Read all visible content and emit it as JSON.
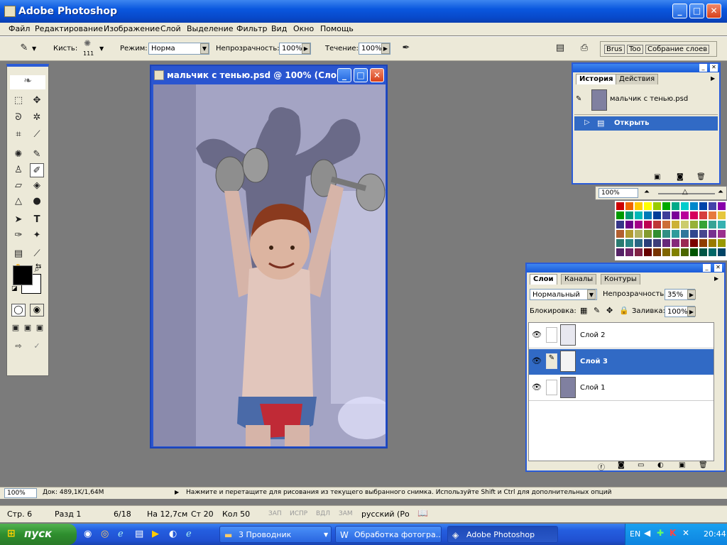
{
  "app": {
    "title": "Adobe Photoshop"
  },
  "menu": [
    "Файл",
    "Редактирование",
    "Изображение",
    "Слой",
    "Выделение",
    "Фильтр",
    "Вид",
    "Окно",
    "Помощь"
  ],
  "options": {
    "brush_label": "Кисть:",
    "brush_size": "111",
    "mode_label": "Режим:",
    "mode_value": "Норма",
    "opacity_label": "Непрозрачность:",
    "opacity_value": "100%",
    "flow_label": "Течение:",
    "flow_value": "100%",
    "well_tabs": [
      "Brus",
      "Too",
      "Собрание слоев"
    ]
  },
  "document": {
    "title": "мальчик с тенью.psd @ 100% (Сло..."
  },
  "history": {
    "tabs": [
      "История",
      "Действия"
    ],
    "snapshot": "мальчик с тенью.psd",
    "states": [
      "Открыть"
    ]
  },
  "navigator": {
    "zoom": "100%"
  },
  "layers": {
    "tabs": [
      "Слои",
      "Каналы",
      "Контуры"
    ],
    "blend_mode": "Нормальный",
    "opacity_label": "Непрозрачность:",
    "opacity_value": "35%",
    "lock_label": "Блокировка:",
    "fill_label": "Заливка:",
    "fill_value": "100%",
    "items": [
      "Слой 2",
      "Слой 3",
      "Слой 1"
    ]
  },
  "status": {
    "zoom": "100%",
    "doc": "Док: 489,1K/1,64M",
    "hint": "Нажмите и перетащите для рисования из текущего выбранного снимка. Используйте Shift и Ctrl для дополнительных опций"
  },
  "statusbar2": {
    "page": "Стр. 6",
    "section": "Разд 1",
    "pages": "6/18",
    "pos": "На 12,7см",
    "line": "Ст 20",
    "col": "Кол 50",
    "rec": "ЗАП",
    "trk": "ИСПР",
    "ext": "ВДЛ",
    "ovr": "ЗАМ",
    "lang": "русский (Ро"
  },
  "taskbar": {
    "start": "пуск",
    "tasks": [
      "3 Проводник",
      "Обработка фотогра...",
      "Adobe Photoshop"
    ],
    "lang": "EN",
    "time": "20:44"
  },
  "colors": {
    "accent": "#2a5bd7",
    "selection": "#316ac5",
    "panel": "#ece9d8"
  }
}
